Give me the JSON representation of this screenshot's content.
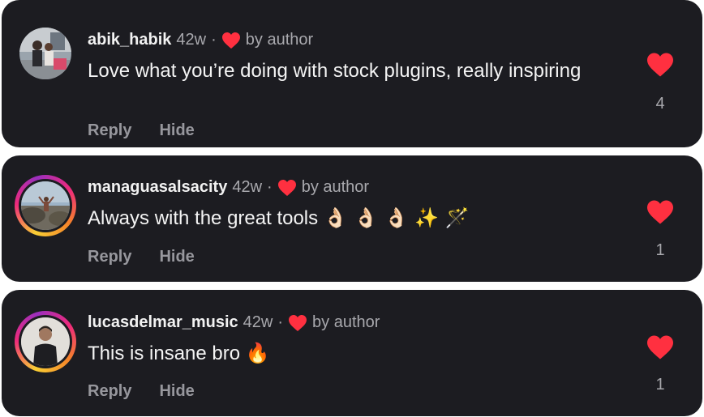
{
  "comments": [
    {
      "username": "abik_habik",
      "age": "42w",
      "separator": "·",
      "author_like": "by author",
      "text": "Love what you’re doing with stock plugins, really inspiring",
      "reply": "Reply",
      "hide": "Hide",
      "likes": "4",
      "has_story_ring": false
    },
    {
      "username": "managuasalsacity",
      "age": "42w",
      "separator": "·",
      "author_like": "by author",
      "text": "Always with the great tools",
      "emoji": "👌🏻 👌🏻 👌🏻 ✨ 🪄",
      "reply": "Reply",
      "hide": "Hide",
      "likes": "1",
      "has_story_ring": true
    },
    {
      "username": "lucasdelmar_music",
      "age": "42w",
      "separator": "·",
      "author_like": "by author",
      "text": "This is insane bro",
      "emoji": "🔥",
      "reply": "Reply",
      "hide": "Hide",
      "likes": "1",
      "has_story_ring": true
    }
  ],
  "colors": {
    "card_bg": "#1c1c21",
    "heart": "#ff3040",
    "text_primary": "#f4f4f4",
    "text_secondary": "#a8a8ad"
  },
  "icons": {
    "author_heart": "heart-icon",
    "like_button": "heart-filled-icon"
  }
}
